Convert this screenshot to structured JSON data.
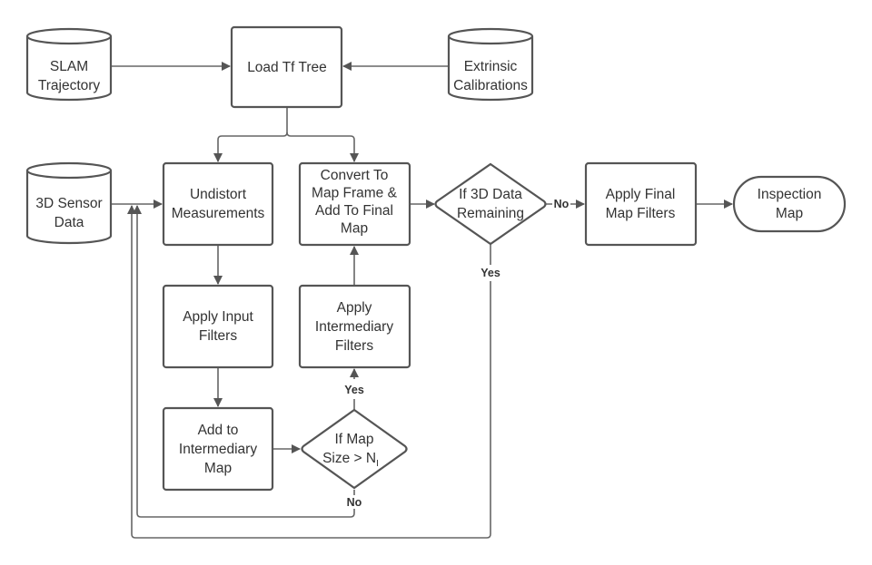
{
  "nodes": {
    "slam": [
      "SLAM",
      "Trajectory"
    ],
    "tf": [
      "Load Tf Tree"
    ],
    "extrinsic": [
      "Extrinsic",
      "Calibrations"
    ],
    "sensor": [
      "3D Sensor",
      "Data"
    ],
    "undistort": [
      "Undistort",
      "Measurements"
    ],
    "convert": [
      "Convert To",
      "Map Frame &",
      "Add To Final",
      "Map"
    ],
    "remaining": [
      "If 3D Data",
      "Remaining"
    ],
    "final_filters": [
      "Apply Final",
      "Map Filters"
    ],
    "inspection": [
      "Inspection",
      "Map"
    ],
    "input_filters": [
      "Apply Input",
      "Filters"
    ],
    "inter_filters": [
      "Apply",
      "Intermediary",
      "Filters"
    ],
    "add_inter": [
      "Add to",
      "Intermediary",
      "Map"
    ],
    "map_size": {
      "line1": "If Map",
      "line2": "Size > N",
      "sub": "I"
    }
  },
  "edges": {
    "remaining_no": "No",
    "remaining_yes": "Yes",
    "map_size_yes": "Yes",
    "map_size_no": "No"
  },
  "colors": {
    "stroke": "#555555",
    "text": "#333333"
  }
}
